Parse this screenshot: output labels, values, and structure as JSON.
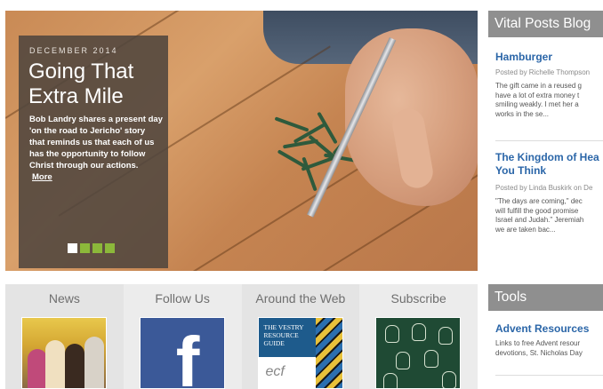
{
  "hero": {
    "date": "DECEMBER 2014",
    "title_line1": "Going That",
    "title_line2": "Extra Mile",
    "description": "Bob Landry shares a present day 'on the road to Jericho' story that reminds us that each of us has the opportunity to follow Christ through our actions.",
    "more_label": "More",
    "slide_count": 4,
    "active_slide": 1,
    "colors": {
      "dot_active": "#ffffff",
      "dot": "#8cb83a",
      "caption_bg": "#50463e"
    }
  },
  "tabs": [
    {
      "label": "News",
      "thumb": "news-photo"
    },
    {
      "label": "Follow Us",
      "thumb": "facebook-logo"
    },
    {
      "label": "Around the Web",
      "thumb": "vestry-resource-guide"
    },
    {
      "label": "Subscribe",
      "thumb": "lightbulbs-chalkboard"
    }
  ],
  "thumbs": {
    "facebook_letter": "f",
    "vestry_text": "THE VESTRY RESOURCE GUIDE",
    "ecf_text": "ecf"
  },
  "sidebar": {
    "blog_heading": "Vital Posts Blog",
    "posts": [
      {
        "title": "Hamburger",
        "meta": "Posted by Richelle Thompson",
        "excerpt": [
          "The gift came in a reused g",
          "have a lot of extra money t",
          "smiling weakly. I met her a",
          "works in the se..."
        ]
      },
      {
        "title_line1": "The Kingdom of Hea",
        "title_line2": "You Think",
        "meta": "Posted by Linda Buskirk on De",
        "excerpt": [
          "\"The days are coming,\" dec",
          "will fulfill the good promise",
          "Israel and Judah.\" Jeremiah",
          "we are taken bac..."
        ]
      }
    ],
    "tools_heading": "Tools",
    "tools": [
      {
        "title": "Advent Resources",
        "excerpt": [
          "Links to free Advent resour",
          "devotions, St. Nicholas Day"
        ]
      }
    ],
    "colors": {
      "heading_bg": "#8f8f8f",
      "link": "#2b66a8"
    }
  }
}
